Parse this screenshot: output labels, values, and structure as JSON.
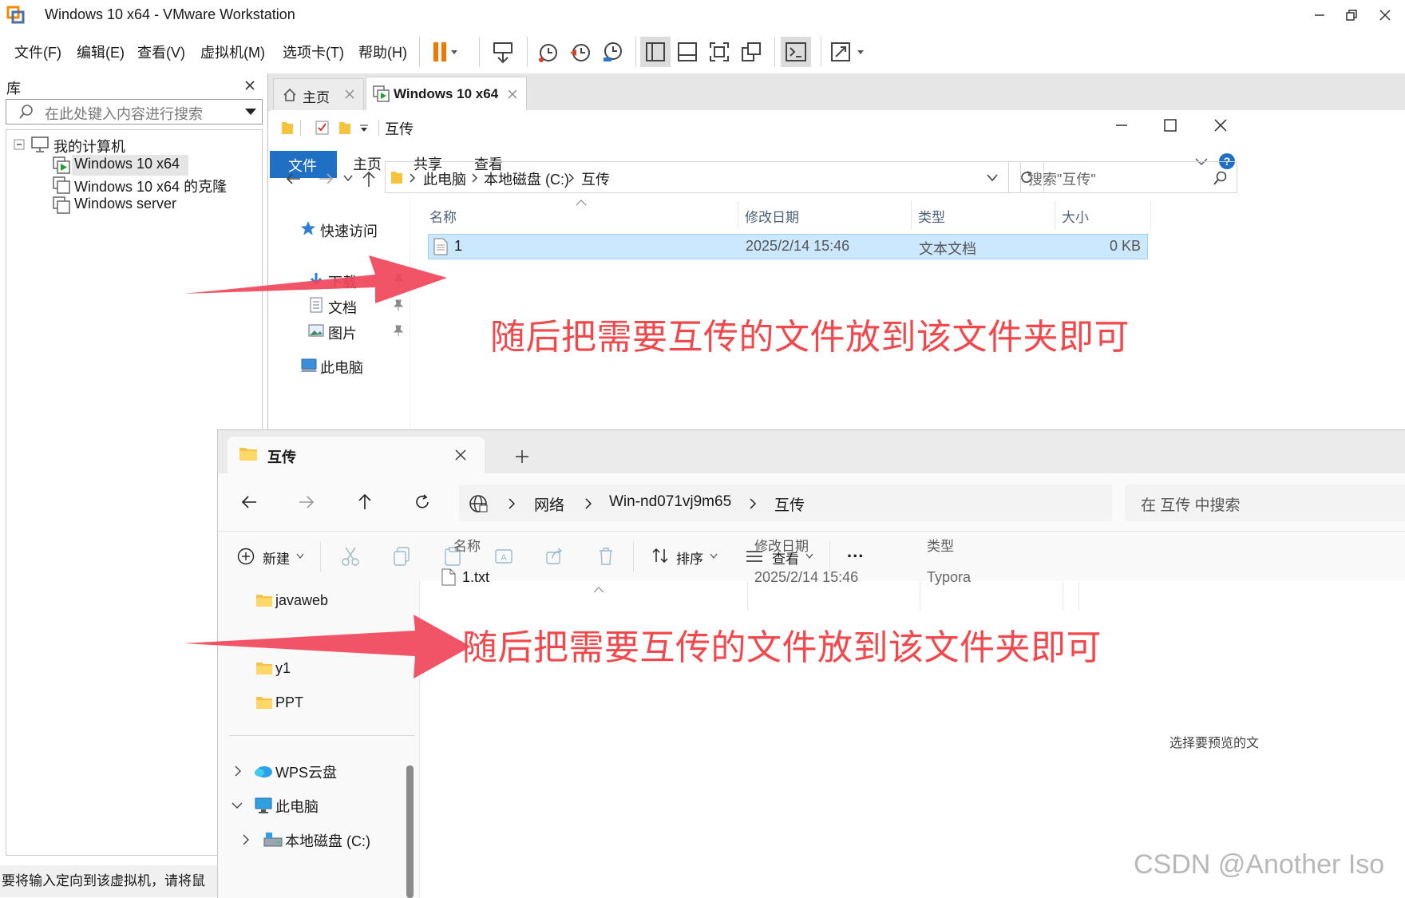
{
  "vmware": {
    "title": "Windows 10 x64 - VMware Workstation",
    "menu": [
      "文件(F)",
      "编辑(E)",
      "查看(V)",
      "虚拟机(M)",
      "选项卡(T)",
      "帮助(H)"
    ],
    "library": {
      "title": "库",
      "search_placeholder": "在此处键入内容进行搜索",
      "tree": {
        "root": "我的计算机",
        "items": [
          "Windows 10 x64",
          "Windows 10 x64 的克隆",
          "Windows server"
        ]
      }
    },
    "tabs": [
      {
        "label": "主页"
      },
      {
        "label": "Windows 10 x64"
      }
    ],
    "status_text": "要将输入定向到该虚拟机，请将鼠"
  },
  "guest_explorer": {
    "title": "互传",
    "ribbon_tabs": [
      "文件",
      "主页",
      "共享",
      "查看"
    ],
    "breadcrumb": [
      "此电脑",
      "本地磁盘 (C:)",
      "互传"
    ],
    "search_placeholder": "搜索\"互传\"",
    "nav": {
      "quick_access": "快速访问",
      "items": [
        "下载",
        "文档",
        "图片"
      ],
      "this_pc": "此电脑"
    },
    "columns": [
      "名称",
      "修改日期",
      "类型",
      "大小"
    ],
    "files": [
      {
        "name": "1",
        "modified": "2025/2/14 15:46",
        "type": "文本文档",
        "size": "0 KB"
      }
    ],
    "annotation": "随后把需要互传的文件放到该文件夹即可"
  },
  "host_explorer": {
    "tab_title": "互传",
    "breadcrumb": [
      "网络",
      "Win-nd071vj9m65",
      "互传"
    ],
    "search_placeholder": "在 互传 中搜索",
    "toolbar": {
      "new": "新建",
      "sort": "排序",
      "view": "查看",
      "more": "..."
    },
    "nav": {
      "folders": [
        "javaweb",
        "y1",
        "PPT"
      ],
      "wps": "WPS云盘",
      "this_pc": "此电脑",
      "local_disk": "本地磁盘 (C:)"
    },
    "columns": [
      "名称",
      "修改日期",
      "类型"
    ],
    "files": [
      {
        "name": "1.txt",
        "modified": "2025/2/14 15:46",
        "type": "Typora"
      }
    ],
    "preview_hint": "选择要预览的文",
    "annotation": "随后把需要互传的文件放到该文件夹即可"
  },
  "watermark": "CSDN @Another Iso",
  "colors": {
    "accent": "#1f6fc5",
    "annotation": "#f2484b",
    "selection": "#cce8ff",
    "arrow": "#f0455a"
  }
}
